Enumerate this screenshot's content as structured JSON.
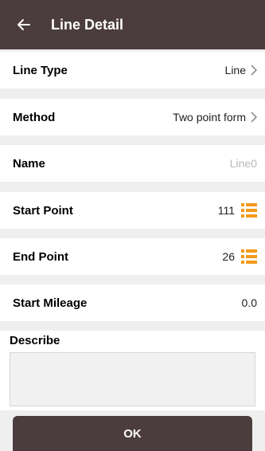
{
  "header": {
    "title": "Line Detail"
  },
  "rows": {
    "line_type": {
      "label": "Line Type",
      "value": "Line"
    },
    "method": {
      "label": "Method",
      "value": "Two point form"
    },
    "name": {
      "label": "Name",
      "placeholder": "Line0"
    },
    "start_point": {
      "label": "Start Point",
      "value": "111"
    },
    "end_point": {
      "label": "End Point",
      "value": "26"
    },
    "start_mileage": {
      "label": "Start Mileage",
      "value": "0.0"
    }
  },
  "describe": {
    "label": "Describe",
    "value": ""
  },
  "ok_button": {
    "label": "OK"
  },
  "colors": {
    "header_bg": "#4b3c3d",
    "accent_orange": "#f39a1c",
    "divider_bg": "#efefef"
  },
  "icons": {
    "back": "back-arrow-icon",
    "chevron": "chevron-right-icon",
    "point_list": "list-icon"
  }
}
